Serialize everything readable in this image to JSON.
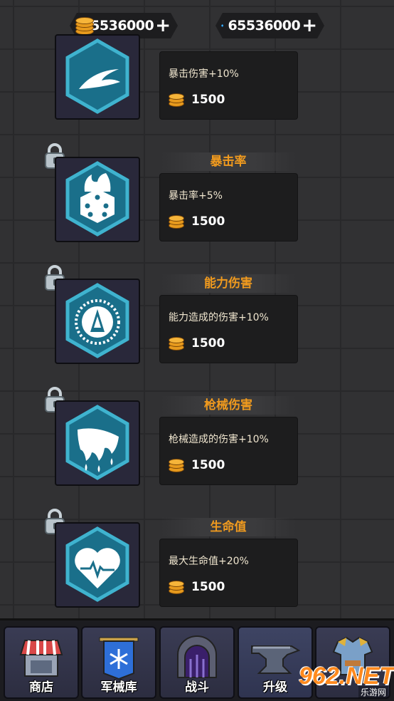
{
  "currency": {
    "gold": {
      "value": "65536000",
      "icon": "gold-coin-stack-icon"
    },
    "gem": {
      "value": "65536000",
      "icon": "blue-gem-icon"
    }
  },
  "upgrades": [
    {
      "title": "",
      "desc": "暴击伤害+10%",
      "cost": "1500",
      "icon": "crit-damage-slash-icon",
      "locked": false
    },
    {
      "title": "暴击率",
      "desc": "暴击率+5%",
      "cost": "1500",
      "icon": "flaming-dice-icon",
      "locked": true
    },
    {
      "title": "能力伤害",
      "desc": "能力造成的伤害+10%",
      "cost": "1500",
      "icon": "spiked-ability-icon",
      "locked": true
    },
    {
      "title": "枪械伤害",
      "desc": "枪械造成的伤害+10%",
      "cost": "1500",
      "icon": "bleeding-claw-icon",
      "locked": true
    },
    {
      "title": "生命值",
      "desc": "最大生命值+20%",
      "cost": "1500",
      "icon": "heartbeat-icon",
      "locked": true
    }
  ],
  "nav": [
    {
      "label": "商店",
      "icon": "shop-icon"
    },
    {
      "label": "军械库",
      "icon": "armory-banner-icon"
    },
    {
      "label": "战斗",
      "icon": "dungeon-gate-icon"
    },
    {
      "label": "升级",
      "icon": "anvil-icon",
      "active": true
    },
    {
      "label": "",
      "icon": "armor-icon"
    }
  ],
  "watermark": {
    "brand": "962.NET",
    "sub": "乐游网"
  },
  "colors": {
    "accent": "#f09a1e",
    "hex_fill": "#1a6f8a",
    "hex_border": "#3fb3cf",
    "panel": "#1d1d1e"
  }
}
